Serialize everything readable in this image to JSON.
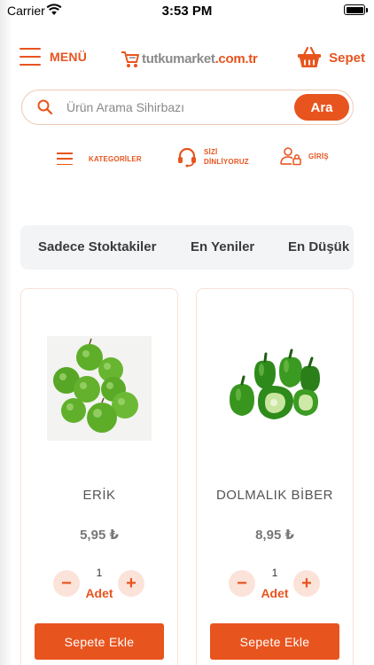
{
  "status_bar": {
    "carrier": "Carrier",
    "time": "3:53 PM"
  },
  "header": {
    "menu_label": "MENÜ",
    "logo": {
      "name": "tutkumarket",
      "domain": ".com.tr"
    },
    "cart_label": "Sepet"
  },
  "search": {
    "placeholder": "Ürün Arama Sihirbazı",
    "button_label": "Ara"
  },
  "quick_nav": {
    "categories": "KATEGORİLER",
    "support_line1": "SİZİ",
    "support_line2": "DİNLİYORUZ",
    "login": "GİRİŞ"
  },
  "filters": [
    "Sadece Stoktakiler",
    "En Yeniler",
    "En Düşük Fiyat"
  ],
  "products": [
    {
      "name": "ERİK",
      "price": "5,95 ₺",
      "quantity": "1",
      "unit": "Adet",
      "add_label": "Sepete Ekle",
      "image": "green-plums"
    },
    {
      "name": "DOLMALIK BİBER",
      "price": "8,95 ₺",
      "quantity": "1",
      "unit": "Adet",
      "add_label": "Sepete Ekle",
      "image": "green-bell-peppers"
    }
  ],
  "colors": {
    "accent": "#e8541e",
    "accent_light": "#fbe3da",
    "filter_bg": "#f3f4f6"
  }
}
